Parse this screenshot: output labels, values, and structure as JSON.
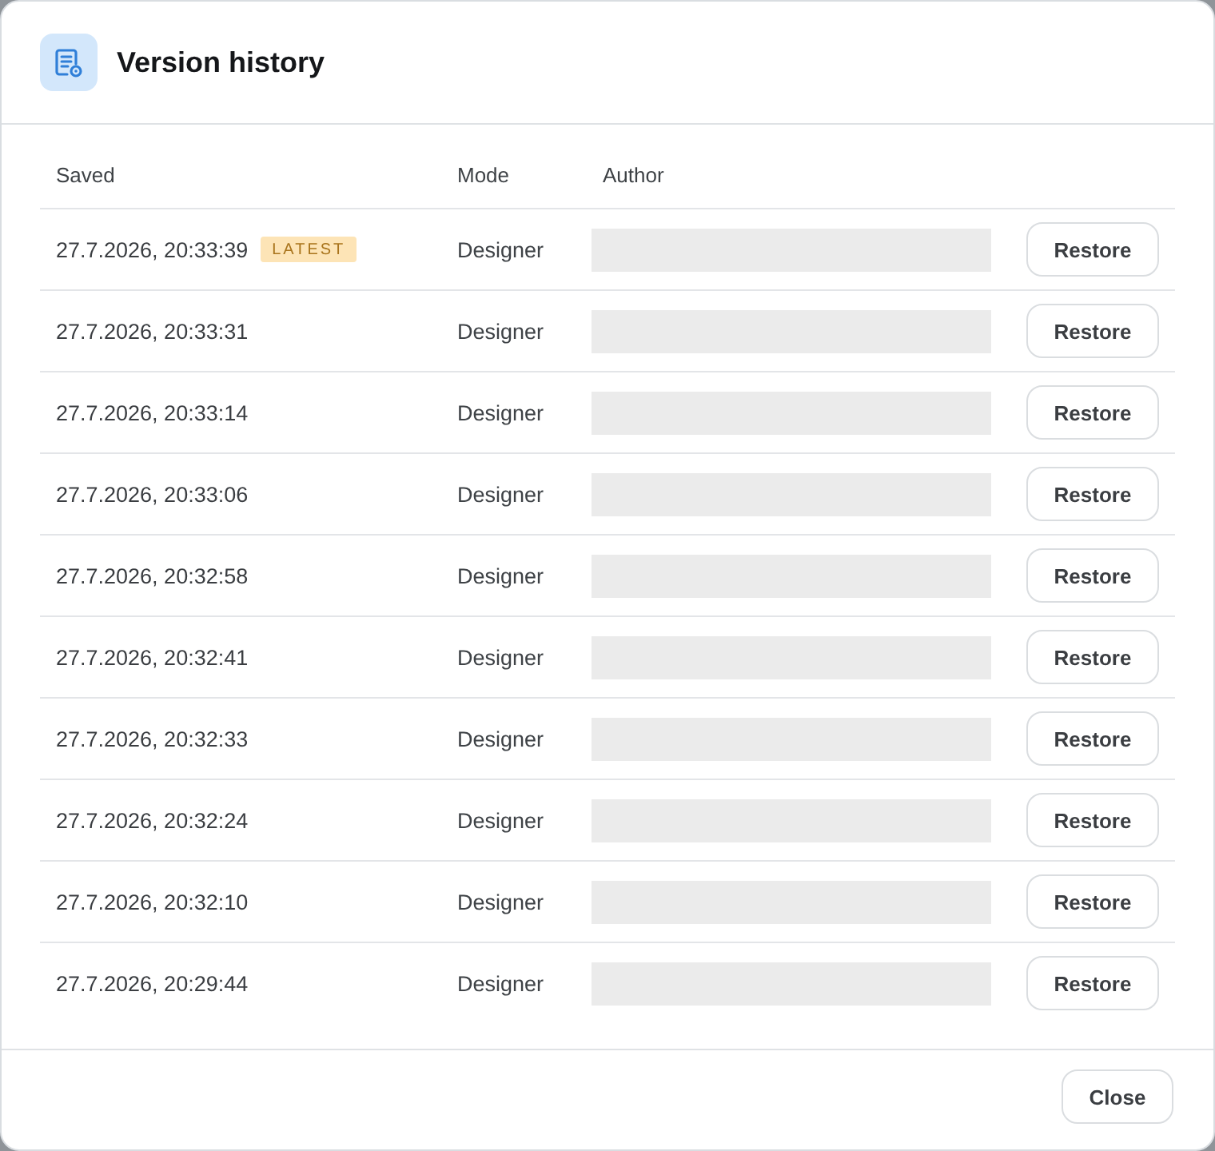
{
  "dialog": {
    "title": "Version history"
  },
  "table": {
    "columns": [
      "Saved",
      "Mode",
      "Author"
    ],
    "rows": [
      {
        "saved": "27.7.2026, 20:33:39",
        "badge": "LATEST",
        "mode": "Designer",
        "action": "Restore"
      },
      {
        "saved": "27.7.2026, 20:33:31",
        "mode": "Designer",
        "action": "Restore"
      },
      {
        "saved": "27.7.2026, 20:33:14",
        "mode": "Designer",
        "action": "Restore"
      },
      {
        "saved": "27.7.2026, 20:33:06",
        "mode": "Designer",
        "action": "Restore"
      },
      {
        "saved": "27.7.2026, 20:32:58",
        "mode": "Designer",
        "action": "Restore"
      },
      {
        "saved": "27.7.2026, 20:32:41",
        "mode": "Designer",
        "action": "Restore"
      },
      {
        "saved": "27.7.2026, 20:32:33",
        "mode": "Designer",
        "action": "Restore"
      },
      {
        "saved": "27.7.2026, 20:32:24",
        "mode": "Designer",
        "action": "Restore"
      },
      {
        "saved": "27.7.2026, 20:32:10",
        "mode": "Designer",
        "action": "Restore"
      },
      {
        "saved": "27.7.2026, 20:29:44",
        "mode": "Designer",
        "action": "Restore"
      }
    ]
  },
  "footer": {
    "buttons": [
      "Close"
    ]
  }
}
